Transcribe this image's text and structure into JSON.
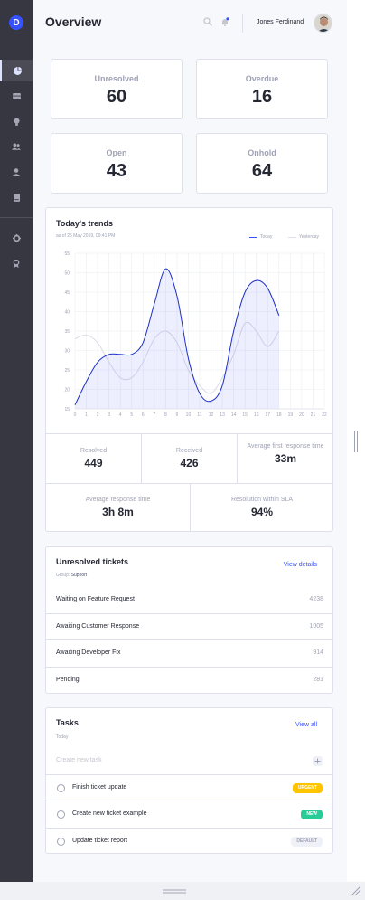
{
  "app": {
    "logo_letter": "D"
  },
  "sidebar": {
    "items": [
      {
        "icon": "pie-chart-icon",
        "active": true
      },
      {
        "icon": "ticket-icon"
      },
      {
        "icon": "lightbulb-icon"
      },
      {
        "icon": "users-icon"
      },
      {
        "icon": "user-icon"
      },
      {
        "icon": "book-icon"
      },
      {
        "icon": "gear-icon"
      },
      {
        "icon": "award-icon"
      }
    ]
  },
  "header": {
    "title": "Overview",
    "user_name": "Jones Ferdinand",
    "icons": [
      "search-icon",
      "bell-icon"
    ]
  },
  "stats": [
    {
      "label": "Unresolved",
      "value": "60"
    },
    {
      "label": "Overdue",
      "value": "16"
    },
    {
      "label": "Open",
      "value": "43"
    },
    {
      "label": "Onhold",
      "value": "64"
    }
  ],
  "trends": {
    "title": "Today's trends",
    "subtitle": "as of 25 May 2019, 09:41 PM",
    "legend_today": "Today",
    "legend_yesterday": "Yesterday",
    "stats": [
      {
        "label": "Resolved",
        "value": "449"
      },
      {
        "label": "Received",
        "value": "426"
      },
      {
        "label": "Average first response time",
        "value": "33m"
      },
      {
        "label": "Average response time",
        "value": "3h 8m"
      },
      {
        "label": "Resolution within SLA",
        "value": "94%"
      }
    ]
  },
  "chart_data": {
    "type": "area",
    "x": [
      0,
      1,
      2,
      3,
      4,
      5,
      6,
      7,
      8,
      9,
      10,
      11,
      12,
      13,
      14,
      15,
      16,
      17,
      18,
      19,
      20,
      21,
      22
    ],
    "xlim": [
      0,
      22
    ],
    "ylim": [
      15,
      55
    ],
    "yticks": [
      15,
      20,
      25,
      30,
      35,
      40,
      45,
      50,
      55
    ],
    "grid": true,
    "legend_position": "top-right",
    "series": [
      {
        "name": "Today",
        "color": "#3751ff",
        "x": [
          0,
          1,
          2,
          3,
          4,
          5,
          6,
          7,
          8,
          9,
          10,
          11,
          12,
          13,
          14,
          15,
          16,
          17,
          18
        ],
        "values": [
          16,
          22,
          27,
          29,
          29,
          29,
          32,
          42,
          51,
          44,
          28,
          19,
          17,
          21,
          35,
          45,
          48,
          46,
          39
        ]
      },
      {
        "name": "Yesterday",
        "color": "#dfe0eb",
        "x": [
          0,
          1,
          2,
          3,
          4,
          5,
          6,
          7,
          8,
          9,
          10,
          11,
          12,
          13,
          14,
          15,
          16,
          17,
          18
        ],
        "values": [
          33,
          34,
          32,
          27,
          23,
          23,
          27,
          33,
          35,
          32,
          25,
          21,
          19,
          23,
          29,
          37,
          35,
          31,
          35
        ]
      }
    ]
  },
  "unresolved": {
    "title": "Unresolved tickets",
    "group_label": "Group:",
    "group_value": "Support",
    "view_link": "View details",
    "rows": [
      {
        "name": "Waiting on Feature Request",
        "count": "4238"
      },
      {
        "name": "Awaiting Customer Response",
        "count": "1005"
      },
      {
        "name": "Awaiting Developer Fix",
        "count": "914"
      },
      {
        "name": "Pending",
        "count": "281"
      }
    ]
  },
  "tasks": {
    "title": "Tasks",
    "subtitle": "Today",
    "view_link": "View all",
    "new_task_placeholder": "Create new task",
    "items": [
      {
        "name": "Finish ticket update",
        "badge": "URGENT",
        "badge_bg": "#fec400",
        "badge_fg": "#ffffff"
      },
      {
        "name": "Create new ticket example",
        "badge": "NEW",
        "badge_bg": "#29cc97",
        "badge_fg": "#ffffff"
      },
      {
        "name": "Update ticket report",
        "badge": "DEFAULT",
        "badge_bg": "#f0f1f7",
        "badge_fg": "#9fa2b4"
      }
    ]
  }
}
